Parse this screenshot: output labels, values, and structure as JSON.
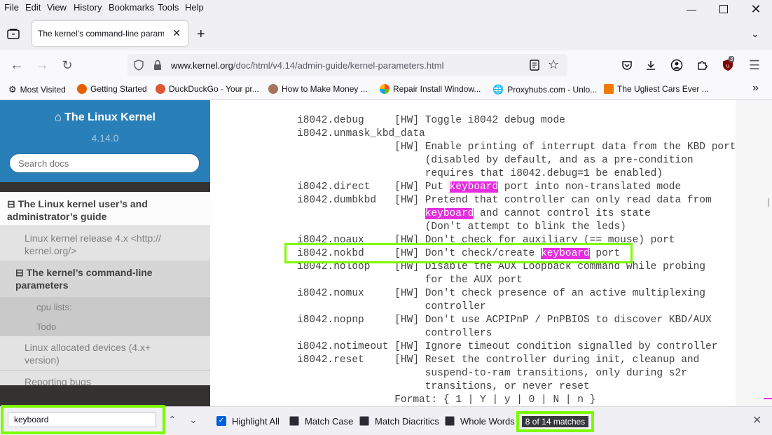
{
  "menu": [
    "File",
    "Edit",
    "View",
    "History",
    "Bookmarks",
    "Tools",
    "Help"
  ],
  "tab": {
    "title": "The kernel’s command-line paramet"
  },
  "address": {
    "host": "www.kernel.org",
    "path": "/doc/html/v4.14/admin-guide/kernel-parameters.html"
  },
  "badge": "3",
  "bookmarks": [
    {
      "label": "Most Visited",
      "color": "#5b5b66"
    },
    {
      "label": "Getting Started",
      "color": "#e66000"
    },
    {
      "label": "DuckDuckGo - Your pr...",
      "color": "#de5833"
    },
    {
      "label": "How to Make Money ...",
      "color": "#a5745a"
    },
    {
      "label": "Repair Install Window...",
      "color": "#3b7cd6"
    },
    {
      "label": "Proxyhubs.com - Unlo...",
      "color": "#5b5b66"
    },
    {
      "label": "The Ugliest Cars Ever ...",
      "color": "#f07c00"
    }
  ],
  "sidebar": {
    "project": "The Linux Kernel",
    "version": "4.14.0",
    "search_placeholder": "Search docs",
    "toc": [
      "⊟ The Linux kernel user’s and administrator’s guide",
      "Linux kernel release 4.x <http:// kernel.org/>",
      "⊟ The kernel’s command-line parameters",
      "cpu lists:",
      "Todo",
      "Linux allocated devices (4.x+ version)",
      "Reporting bugs"
    ]
  },
  "code_lines": [
    [
      {
        "t": "i8042.debug     [HW] Toggle i8042 debug mode"
      }
    ],
    [
      {
        "t": "i8042.unmask_kbd_data"
      }
    ],
    [
      {
        "t": "                [HW] Enable printing of interrupt data from the KBD port"
      }
    ],
    [
      {
        "t": "                     (disabled by default, and as a pre-condition"
      }
    ],
    [
      {
        "t": "                     requires that i8042.debug=1 be enabled)"
      }
    ],
    [
      {
        "t": "i8042.direct    [HW] Put "
      },
      {
        "t": "keyboard",
        "h": true
      },
      {
        "t": " port into non-translated mode"
      }
    ],
    [
      {
        "t": "i8042.dumbkbd   [HW] Pretend that controller can only read data from"
      }
    ],
    [
      {
        "t": "                     "
      },
      {
        "t": "keyboard",
        "h": true
      },
      {
        "t": " and cannot control its state"
      }
    ],
    [
      {
        "t": "                     (Don't attempt to blink the leds)"
      }
    ],
    [
      {
        "t": "i8042.noaux     [HW] Don't check for auxiliary (== mouse) port"
      }
    ],
    [
      {
        "t": "i8042.nokbd     [HW] Don't check/create "
      },
      {
        "t": "keyboard",
        "h": true
      },
      {
        "t": " port"
      }
    ],
    [
      {
        "t": "i8042.noloop    [HW] Disable the AUX Loopback command while probing"
      }
    ],
    [
      {
        "t": "                     for the AUX port"
      }
    ],
    [
      {
        "t": "i8042.nomux     [HW] Don't check presence of an active multiplexing"
      }
    ],
    [
      {
        "t": "                     controller"
      }
    ],
    [
      {
        "t": "i8042.nopnp     [HW] Don't use ACPIPnP / PnPBIOS to discover KBD/AUX"
      }
    ],
    [
      {
        "t": "                     controllers"
      }
    ],
    [
      {
        "t": "i8042.notimeout [HW] Ignore timeout condition signalled by controller"
      }
    ],
    [
      {
        "t": "i8042.reset     [HW] Reset the controller during init, cleanup and"
      }
    ],
    [
      {
        "t": "                     suspend-to-ram transitions, only during s2r"
      }
    ],
    [
      {
        "t": "                     transitions, or never reset"
      }
    ],
    [
      {
        "t": "                Format: { 1 | Y | y | 0 | N | n }"
      }
    ]
  ],
  "findbar": {
    "query": "keyboard",
    "highlight_all": "Highlight All",
    "highlight_checked": true,
    "match_case": "Match Case",
    "match_diacritics": "Match Diacritics",
    "whole_words": "Whole Words",
    "match_count": "8 of 14 matches"
  },
  "colors": {
    "highlight": "#e52ee0",
    "accent_green": "#7cfc00",
    "sidebar_header": "#2980b9"
  }
}
